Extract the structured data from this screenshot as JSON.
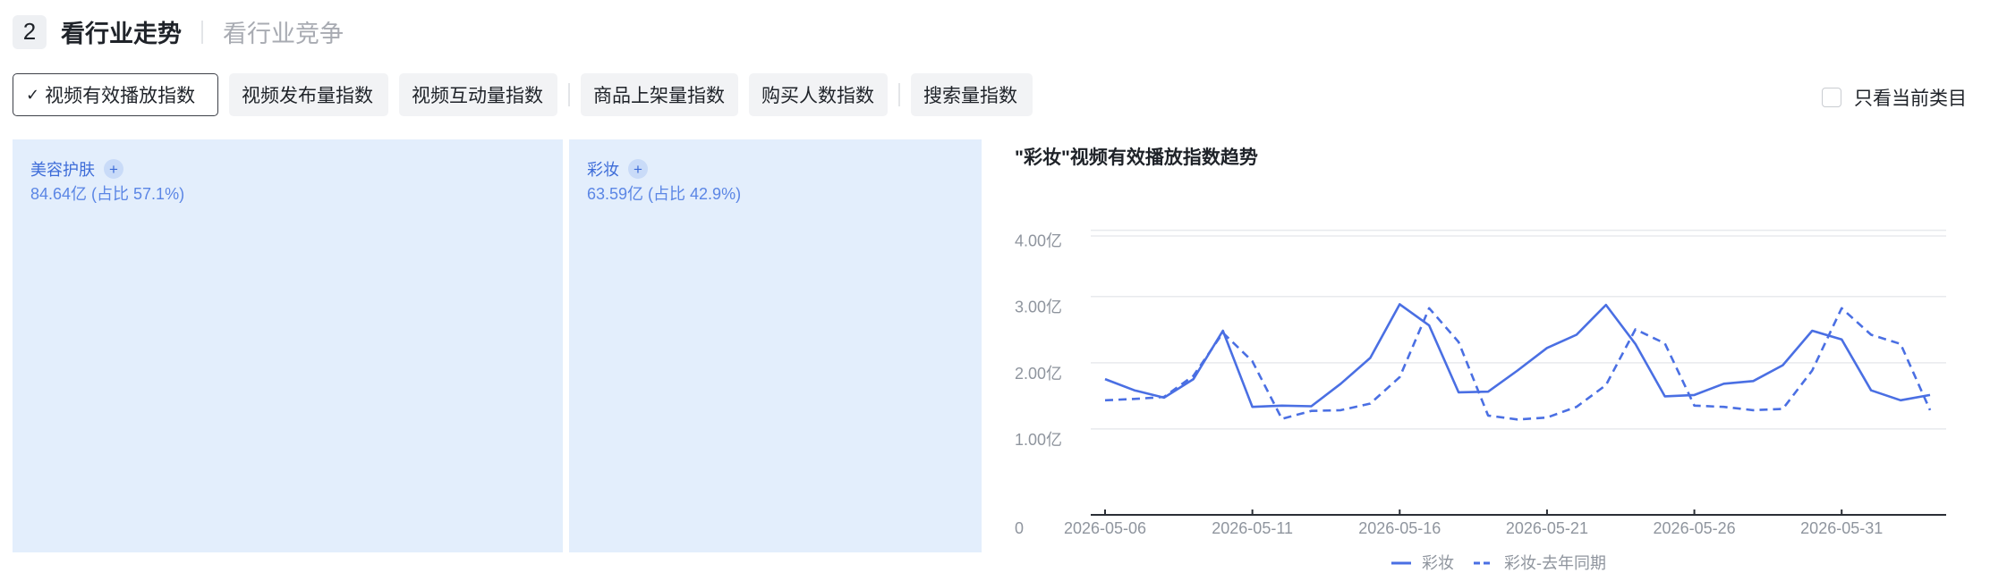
{
  "header": {
    "step": "2",
    "title": "看行业走势",
    "subtitle": "看行业竞争"
  },
  "tabs": [
    {
      "label": "视频有效播放指数",
      "active": true
    },
    {
      "label": "视频发布量指数"
    },
    {
      "label": "视频互动量指数"
    },
    {
      "label": "商品上架量指数"
    },
    {
      "label": "购买人数指数"
    },
    {
      "label": "搜索量指数"
    }
  ],
  "filter": {
    "only_current_label": "只看当前类目",
    "checked": false
  },
  "treemap": [
    {
      "name": "美容护肤",
      "value": "84.64亿 (占比 57.1%)",
      "share": 57.1
    },
    {
      "name": "彩妆",
      "value": "63.59亿 (占比 42.9%)",
      "share": 42.9
    }
  ],
  "colors": {
    "accent": "#4a6fe3",
    "treemap_fill": "#e3eefc",
    "treemap_text": "#3d6cd8"
  },
  "chart_data": {
    "type": "line",
    "title": "\"彩妆\"视频有效播放指数趋势",
    "ylim": [
      0,
      4.4
    ],
    "yticks": [
      0,
      1,
      2,
      3,
      4
    ],
    "ytick_labels": [
      "0",
      "1.00亿",
      "2.00亿",
      "3.00亿",
      "4.00亿"
    ],
    "xtick_labels": [
      "2026-05-06",
      "2026-05-11",
      "2026-05-16",
      "2026-05-21",
      "2026-05-26",
      "2026-05-31"
    ],
    "x": [
      "05-06",
      "05-07",
      "05-08",
      "05-09",
      "05-10",
      "05-11",
      "05-12",
      "05-13",
      "05-14",
      "05-15",
      "05-16",
      "05-17",
      "05-18",
      "05-19",
      "05-20",
      "05-21",
      "05-22",
      "05-23",
      "05-24",
      "05-25",
      "05-26",
      "05-27",
      "05-28",
      "05-29",
      "05-30",
      "05-31",
      "06-01",
      "06-02",
      "06-03"
    ],
    "grid": true,
    "legend_position": "bottom-center",
    "series": [
      {
        "name": "彩妆",
        "dash": false,
        "values": [
          2.05,
          1.88,
          1.77,
          2.05,
          2.78,
          1.63,
          1.65,
          1.64,
          1.98,
          2.37,
          3.18,
          2.86,
          1.85,
          1.86,
          2.18,
          2.52,
          2.72,
          3.17,
          2.58,
          1.79,
          1.81,
          1.98,
          2.02,
          2.26,
          2.78,
          2.65,
          1.88,
          1.73,
          1.81
        ]
      },
      {
        "name": "彩妆-去年同期",
        "dash": true,
        "values": [
          1.73,
          1.75,
          1.78,
          2.1,
          2.75,
          2.32,
          1.45,
          1.57,
          1.58,
          1.68,
          2.08,
          3.12,
          2.61,
          1.5,
          1.44,
          1.47,
          1.63,
          1.96,
          2.8,
          2.59,
          1.65,
          1.63,
          1.58,
          1.6,
          2.18,
          3.12,
          2.72,
          2.58,
          1.58
        ]
      }
    ]
  }
}
